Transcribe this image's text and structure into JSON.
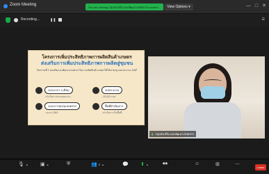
{
  "window": {
    "title": "Zoom Meeting",
    "viewing_banner": "You are viewing กลุ่มส่งเสริม และพัฒนาเกษตรกร's screen",
    "view_options": "View Options ▾"
  },
  "top_bar": {
    "recording_label": "Recording...",
    "gallery": "☰"
  },
  "slide": {
    "title1": "โครงการเพิ่มประสิทธิภาพการผลิตสินค้าเกษตร",
    "title2": "ส่งเสริมการเพิ่มประสิทธิภาพการผลิตสู่ชุมชน",
    "desc": "กิจกรรมที่ 1 ส่งเสริมและพัฒนาเกษตรกรในการผลิตสินค้าเกษตรให้ได้มาตรฐานตามระบบ GAP",
    "items": [
      {
        "title": "ระยะเวลา 3 เดือน",
        "sub": "- ดำเนินการตามแผนงาน"
      },
      {
        "title": "งบประมาณ",
        "sub": "- 25,000 บาท"
      },
      {
        "title": "ระยะการอบรมเกษตรกร",
        "sub": "- อบรม 2563"
      },
      {
        "title": "พื้นที่ดำเนินการ",
        "sub": "- ดำเนินการในพื้นที่"
      }
    ]
  },
  "video": {
    "participant_name": "กลุ่มส่งเสริม และพัฒนาเกษตรกร"
  },
  "toolbar": {
    "leave_label": "Leave",
    "participants_count": "2"
  },
  "colors": {
    "banner": "#22b14c",
    "slide_bg": "#f6e7c9",
    "accent": "#2c73b8",
    "leave": "#d93025"
  }
}
